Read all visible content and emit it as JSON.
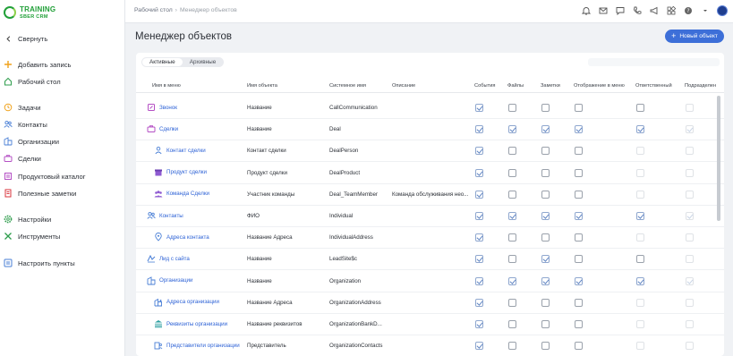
{
  "brand": {
    "title": "TRAINING",
    "subtitle": "SBER CRM"
  },
  "sidebar": {
    "items": [
      {
        "label": "Свернуть",
        "icon": "chevron-left-icon"
      },
      {
        "label": "Добавить запись",
        "icon": "plus-icon"
      },
      {
        "label": "Рабочий стол",
        "icon": "home-icon"
      },
      {
        "label": "Задачи",
        "icon": "clock-icon"
      },
      {
        "label": "Контакты",
        "icon": "users-icon"
      },
      {
        "label": "Организации",
        "icon": "building-icon"
      },
      {
        "label": "Сделки",
        "icon": "briefcase-icon"
      },
      {
        "label": "Продуктовый каталог",
        "icon": "catalog-icon"
      },
      {
        "label": "Полезные заметки",
        "icon": "notes-icon"
      },
      {
        "label": "Настройки",
        "icon": "gear-icon"
      },
      {
        "label": "Инструменты",
        "icon": "tools-icon"
      },
      {
        "label": "Настроить пункты",
        "icon": "configure-icon"
      }
    ]
  },
  "topbar": {
    "breadcrumb": [
      "Рабочий стол",
      "Менеджер объектов"
    ],
    "icons": [
      "bell-icon",
      "mail-icon",
      "chat-icon",
      "phone-icon",
      "megaphone-icon",
      "apps-icon",
      "help-icon",
      "dropdown-icon",
      "avatar"
    ]
  },
  "main": {
    "title": "Менеджер объектов",
    "new_button": "Новый объект",
    "tabs": [
      {
        "label": "Активные",
        "active": true
      },
      {
        "label": "Архивные",
        "active": false
      }
    ],
    "columns": [
      "Имя в меню",
      "Имя объекта",
      "Системное имя",
      "Описание",
      "События",
      "Файлы",
      "Заметки",
      "Отображение в меню",
      "Ответственный",
      "Подразделен"
    ],
    "rows": [
      {
        "menu": "Звонок",
        "object": "Название",
        "system": "CallCommunication",
        "desc": "",
        "child": false,
        "icon": "phone-note-icon",
        "flags": [
          1,
          0,
          0,
          0,
          0,
          0
        ]
      },
      {
        "menu": "Сделки",
        "object": "Название",
        "system": "Deal",
        "desc": "",
        "child": false,
        "icon": "briefcase-icon",
        "flags": [
          1,
          1,
          1,
          1,
          1,
          1
        ]
      },
      {
        "menu": "Контакт сделки",
        "object": "Контакт сделки",
        "system": "DealPerson",
        "desc": "",
        "child": true,
        "icon": "person-icon",
        "flags": [
          1,
          0,
          0,
          0,
          0,
          0
        ]
      },
      {
        "menu": "Продукт сделки",
        "object": "Продукт сделки",
        "system": "DealProduct",
        "desc": "",
        "child": true,
        "icon": "box-icon",
        "flags": [
          1,
          0,
          0,
          0,
          0,
          0
        ]
      },
      {
        "menu": "Команда Сделки",
        "object": "Участник команды",
        "system": "Deal_TeamMember",
        "desc": "Команда обслуживания нео...",
        "child": true,
        "icon": "team-icon",
        "flags": [
          1,
          0,
          0,
          0,
          0,
          0
        ]
      },
      {
        "menu": "Контакты",
        "object": "ФИО",
        "system": "Individual",
        "desc": "",
        "child": false,
        "icon": "users-icon",
        "flags": [
          1,
          1,
          1,
          1,
          1,
          1
        ]
      },
      {
        "menu": "Адреса контакта",
        "object": "Название Адреса",
        "system": "IndividualAddress",
        "desc": "",
        "child": true,
        "icon": "pin-icon",
        "flags": [
          1,
          0,
          0,
          0,
          0,
          0
        ]
      },
      {
        "menu": "Лид с сайта",
        "object": "Название",
        "system": "LeadSite$c",
        "desc": "",
        "child": false,
        "icon": "lead-icon",
        "flags": [
          1,
          0,
          1,
          0,
          0,
          0
        ]
      },
      {
        "menu": "Организации",
        "object": "Название",
        "system": "Organization",
        "desc": "",
        "child": false,
        "icon": "building-icon",
        "flags": [
          1,
          1,
          1,
          1,
          1,
          1
        ]
      },
      {
        "menu": "Адреса организации",
        "object": "Название Адреса",
        "system": "OrganizationAddress",
        "desc": "",
        "child": true,
        "icon": "org-address-icon",
        "flags": [
          1,
          0,
          0,
          0,
          0,
          0
        ]
      },
      {
        "menu": "Реквизиты организации",
        "object": "Название реквизитов",
        "system": "OrganizationBankD...",
        "desc": "",
        "child": true,
        "icon": "bank-icon",
        "flags": [
          1,
          0,
          0,
          0,
          0,
          0
        ]
      },
      {
        "menu": "Представители организации",
        "object": "Представитель",
        "system": "OrganizationContacts",
        "desc": "",
        "child": true,
        "icon": "org-people-icon",
        "flags": [
          1,
          0,
          0,
          0,
          0,
          0
        ]
      }
    ]
  }
}
